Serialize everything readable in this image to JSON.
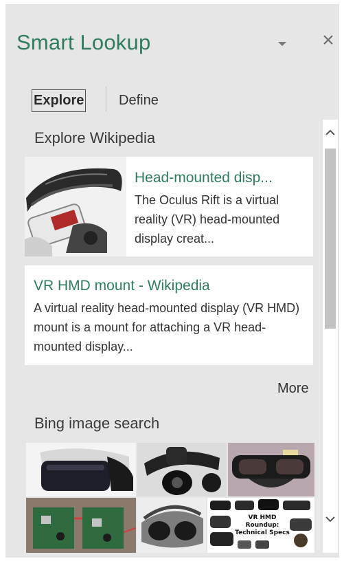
{
  "pane": {
    "title": "Smart Lookup"
  },
  "tabs": [
    {
      "label": "Explore",
      "selected": true
    },
    {
      "label": "Define",
      "selected": false
    }
  ],
  "wikipedia": {
    "heading": "Explore Wikipedia",
    "results": [
      {
        "title": "Head-mounted disp...",
        "snippet": "The Oculus Rift is a virtual reality (VR) head-mounted display creat...",
        "thumbnail": "vr-headset-image"
      },
      {
        "title": "VR HMD mount - Wikipedia",
        "snippet": "A virtual reality head-mounted display (VR HMD) mount is a mount for attaching a VR head-mounted display..."
      }
    ],
    "more_label": "More"
  },
  "bing": {
    "heading": "Bing image search",
    "images": [
      {
        "name": "vr-headset-white-image"
      },
      {
        "name": "vr-headset-strap-image"
      },
      {
        "name": "vr-goggles-image"
      },
      {
        "name": "vr-circuit-board-image"
      },
      {
        "name": "vr-headset-gray-image"
      },
      {
        "name": "vr-hmd-roundup-image",
        "caption_line1": "VR HMD Roundup:",
        "caption_line2": "Technical Specs"
      }
    ]
  },
  "icons": {
    "dropdown": "chevron-down-icon",
    "close": "close-icon",
    "scroll_up": "chevron-up-icon",
    "scroll_down": "chevron-down-icon"
  },
  "colors": {
    "accent": "#2e7d5b",
    "pane_bg": "#e6e6e6",
    "card_bg": "#ffffff",
    "text": "#333333"
  }
}
